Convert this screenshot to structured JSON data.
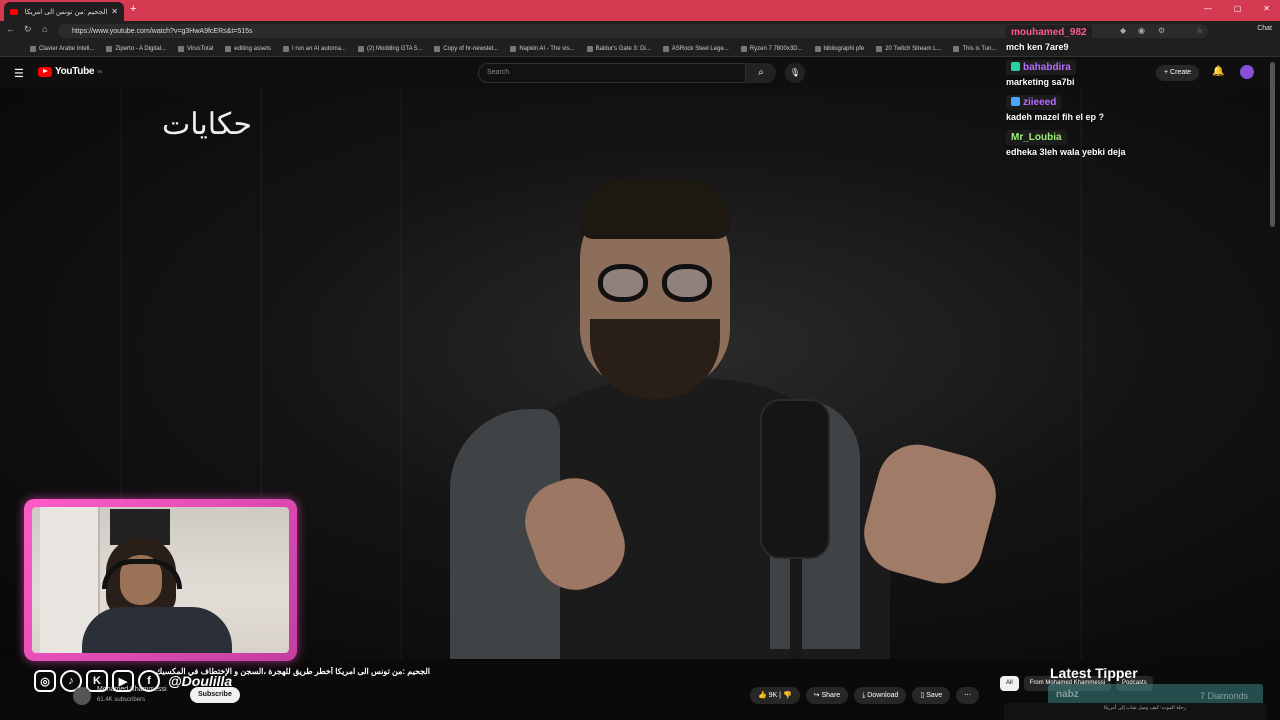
{
  "browser": {
    "tab_title": "الجحيم :من تونس الى امريكا أخطر طريق",
    "url": "https://www.youtube.com/watch?v=g3HwA9fcERs&t=515s",
    "window_controls": [
      "—",
      "▢",
      "✕"
    ],
    "chat_label": "Chat",
    "bookmarks": [
      "Clavier Arabe Intell...",
      "Ziperto - A Digital...",
      "VirusTotal",
      "editing assets",
      "I run an AI automa...",
      "(2) Modding GTA 5...",
      "Copy of hr-newslet...",
      "Napkin AI - The vis...",
      "Baldur's Gate 3: Di...",
      "ASRock Steel Lege...",
      "Ryzen 7 7800x3D...",
      "bibliographi pfe",
      "20 Twitch Stream L...",
      "This is Tun..."
    ]
  },
  "youtube": {
    "logo_text": "YouTube",
    "logo_sup": "TN",
    "search_placeholder": "Search",
    "create_label": "Create",
    "video_watermark": "حكايات",
    "video_title": "الجحيم :من تونس الى امريكا أخطر طريق للهجرة ،السجن و الإختطاف في المكسيك",
    "channel_name": "Mohamed Khammessi",
    "subscribers": "61.4K subscribers",
    "subscribe_label": "Subscribe",
    "like_count": "9K",
    "share_label": "Share",
    "download_label": "Download",
    "save_label": "Save",
    "more_label": "⋯",
    "chips": [
      "All",
      "From Mohamed Khammessi",
      "Podcasts"
    ],
    "rec_text": "رحلة الموت: كيف وصل شاب إلى أمريكا"
  },
  "overlay": {
    "social_handle": "@Doulilla",
    "social_icons": [
      "instagram-icon",
      "tiktok-icon",
      "kick-icon",
      "youtube-icon",
      "facebook-icon"
    ],
    "latest_tipper_title": "Latest Tipper",
    "latest_tipper_name": "nabz",
    "latest_tipper_amount": "7 Diamonds"
  },
  "chat": [
    {
      "user": "mouhamed_982",
      "color": "#ff5a8a",
      "text": "mch ken 7are9",
      "badge": ""
    },
    {
      "user": "bahabdira",
      "color": "#b86cff",
      "text": "marketing sa7bi",
      "badge": "#2ad1a8"
    },
    {
      "user": "ziieeed",
      "color": "#b86cff",
      "text": "kadeh mazel fih el ep ?",
      "badge": "#4aa6ff"
    },
    {
      "user": "Mr_Loubia",
      "color": "#9df07a",
      "text": "edheka 3leh wala yebki deja",
      "badge": ""
    }
  ]
}
